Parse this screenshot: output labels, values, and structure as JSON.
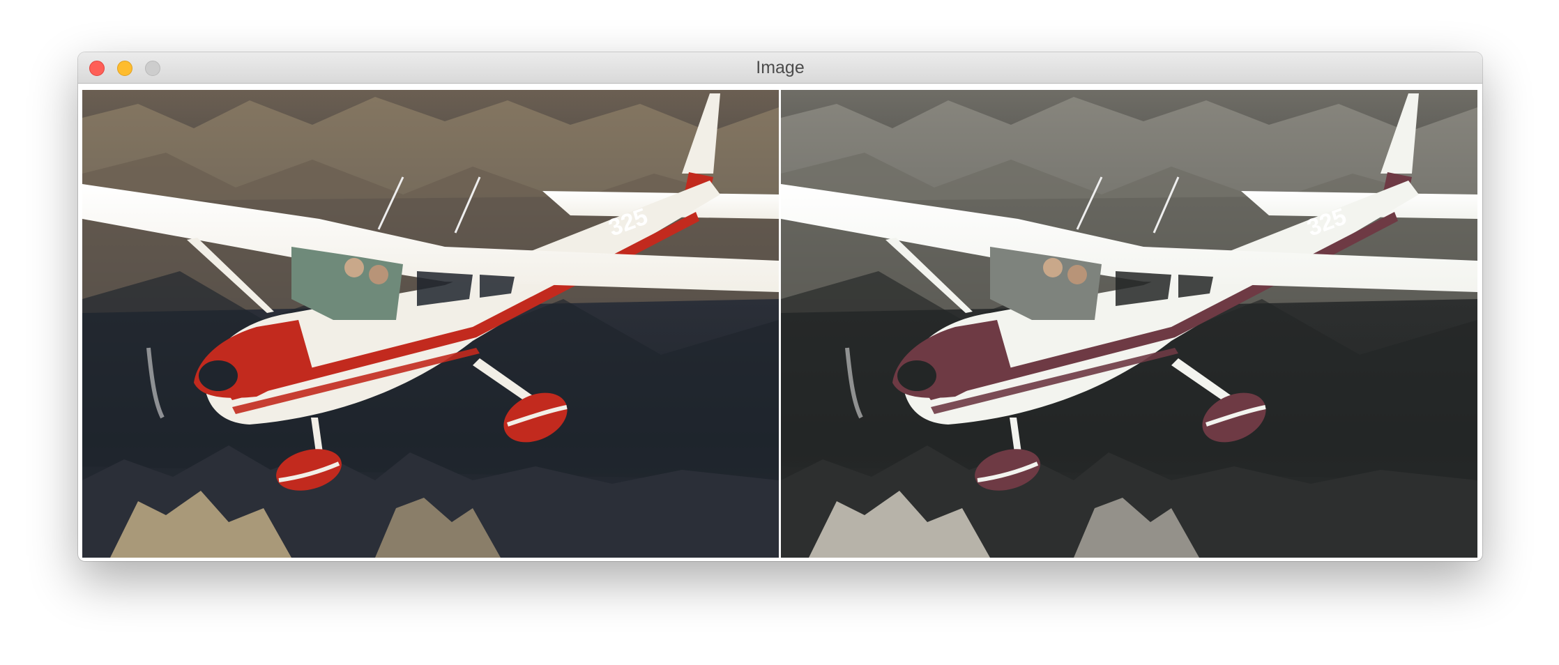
{
  "window": {
    "title": "Image",
    "controls": [
      "close-button",
      "minimize-button",
      "zoom-button"
    ]
  },
  "panes": [
    {
      "name": "original",
      "palette": {
        "sky_mountains": "#6b5f52",
        "mountain_dark": "#2b2f38",
        "mountain_light": "#9a8a70",
        "shadow": "#1f252d",
        "plane_body": "#f2efe7",
        "stripe": "#c22a1e",
        "cockpit_glass": "#6f8a7a",
        "cliffs": "#c9b48a"
      }
    },
    {
      "name": "processed",
      "palette": {
        "sky_mountains": "#6f6d66",
        "mountain_dark": "#2d2f2f",
        "mountain_light": "#9d9a92",
        "shadow": "#232626",
        "plane_body": "#f3f4ef",
        "stripe": "#6e3a44",
        "cockpit_glass": "#7e837d",
        "cliffs": "#d9d4c8"
      }
    }
  ],
  "plane": {
    "registration_fragment": "325"
  }
}
